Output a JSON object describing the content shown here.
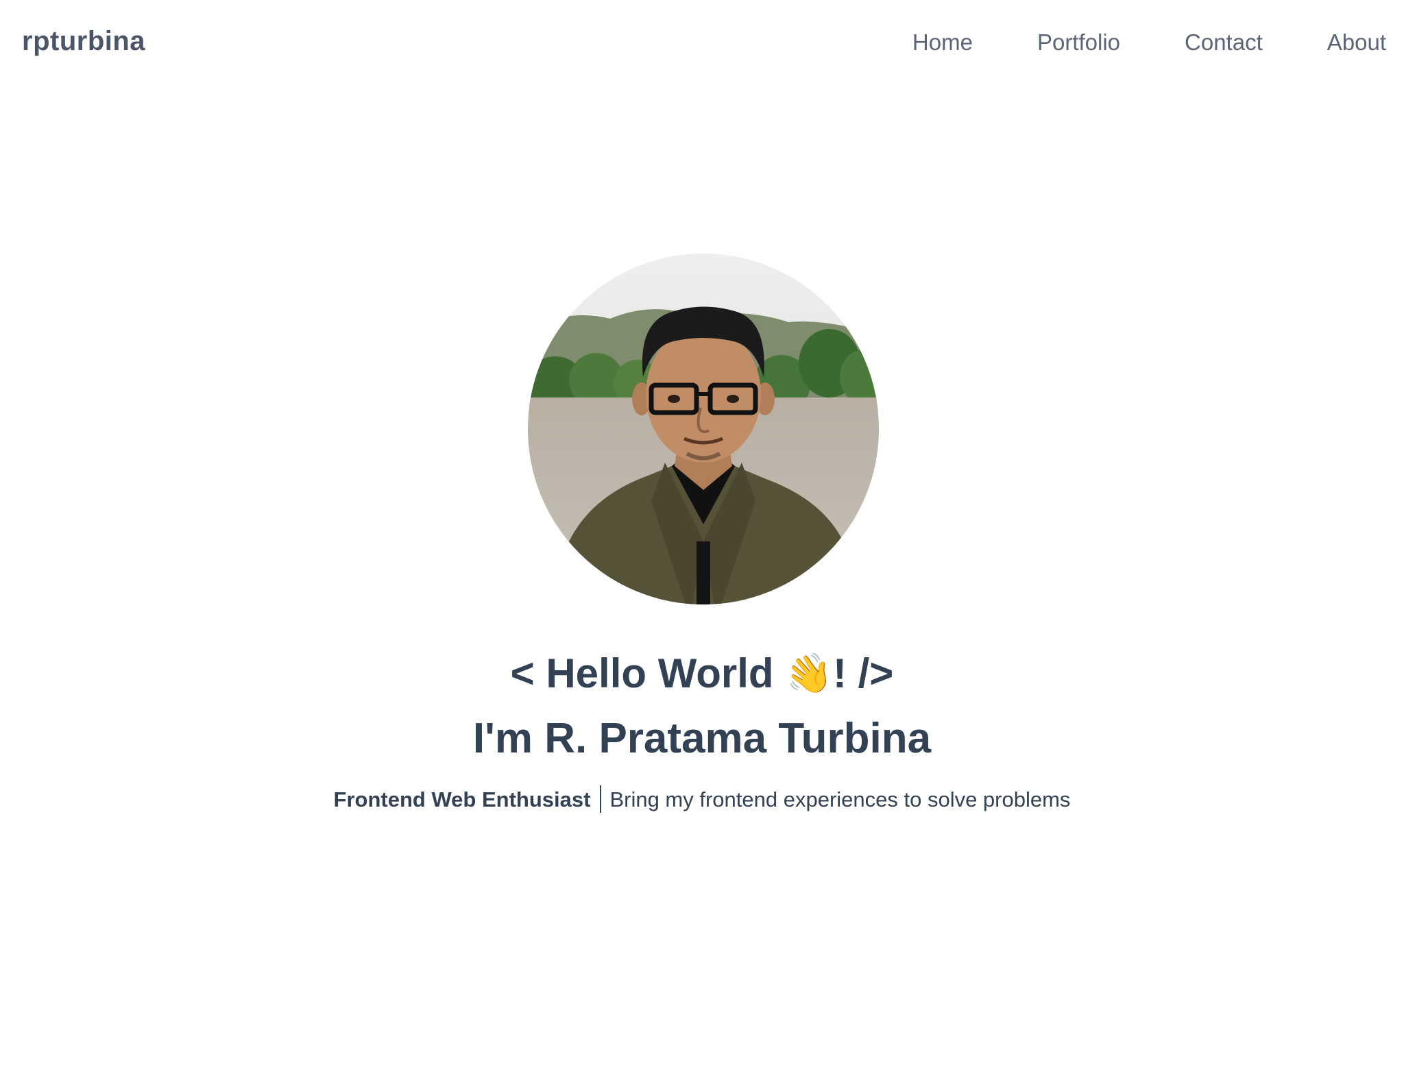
{
  "header": {
    "brand": "rpturbina",
    "nav": [
      {
        "label": "Home"
      },
      {
        "label": "Portfolio"
      },
      {
        "label": "Contact"
      },
      {
        "label": "About"
      }
    ]
  },
  "hero": {
    "greeting_prefix": "< Hello World",
    "greeting_emoji": "👋",
    "greeting_suffix": "! />",
    "name": "I'm R. Pratama Turbina",
    "role": "Frontend Web Enthusiast",
    "description": "Bring my frontend experiences to solve problems"
  },
  "colors": {
    "text": "#334155",
    "nav_text": "#5b6577",
    "background": "#ffffff"
  }
}
